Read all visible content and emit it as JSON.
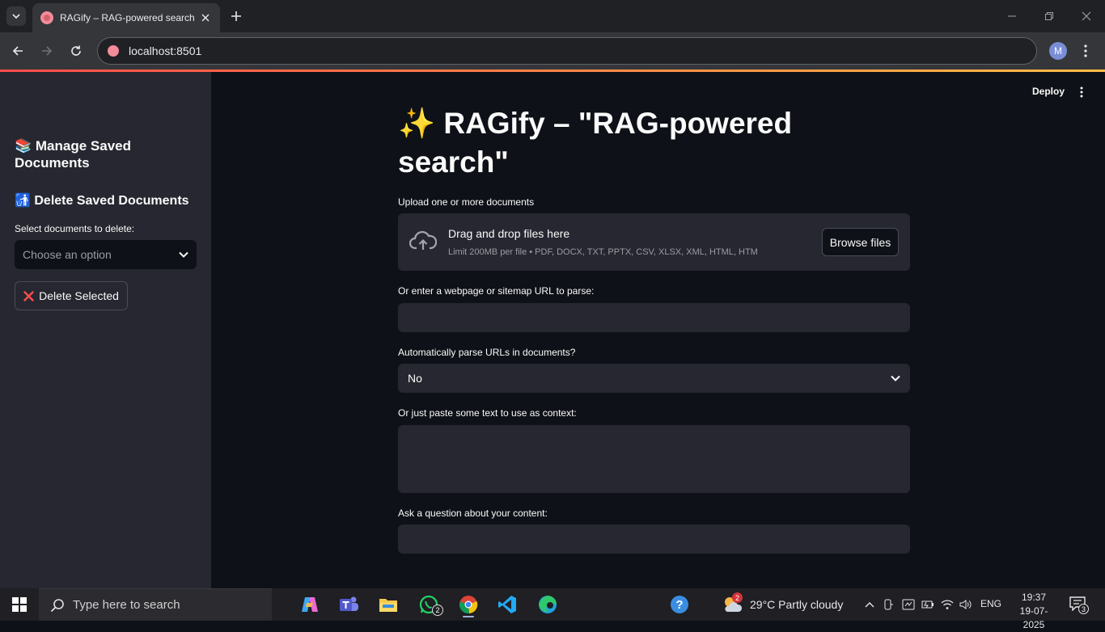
{
  "browser": {
    "tab_title": "RAGify – RAG-powered search",
    "url": "localhost:8501",
    "profile_initial": "M"
  },
  "sidebar": {
    "manage_title": "📚 Manage Saved Documents",
    "delete_title": "🚮 Delete Saved Documents",
    "select_label": "Select documents to delete:",
    "select_placeholder": "Choose an option",
    "delete_button": "Delete Selected"
  },
  "app": {
    "deploy_label": "Deploy",
    "title": "✨ RAGify – \"RAG-powered search\"",
    "upload_label": "Upload one or more documents",
    "drop_text": "Drag and drop files here",
    "limit_text": "Limit 200MB per file • PDF, DOCX, TXT, PPTX, CSV, XLSX, XML, HTML, HTM",
    "browse_button": "Browse files",
    "url_label": "Or enter a webpage or sitemap URL to parse:",
    "url_value": "",
    "auto_parse_label": "Automatically parse URLs in documents?",
    "auto_parse_value": "No",
    "context_label": "Or just paste some text to use as context:",
    "context_value": "",
    "question_label": "Ask a question about your content:",
    "question_value": ""
  },
  "taskbar": {
    "search_placeholder": "Type here to search",
    "whatsapp_badge": "2",
    "weather_badge": "2",
    "weather": "29°C  Partly cloudy",
    "language": "ENG",
    "time": "19:37",
    "date": "19-07-2025",
    "notifications": "3"
  },
  "colors": {
    "accent_start": "#ff4b4b",
    "accent_end": "#ffbd45",
    "delete_icon": "#ff4b4b"
  }
}
